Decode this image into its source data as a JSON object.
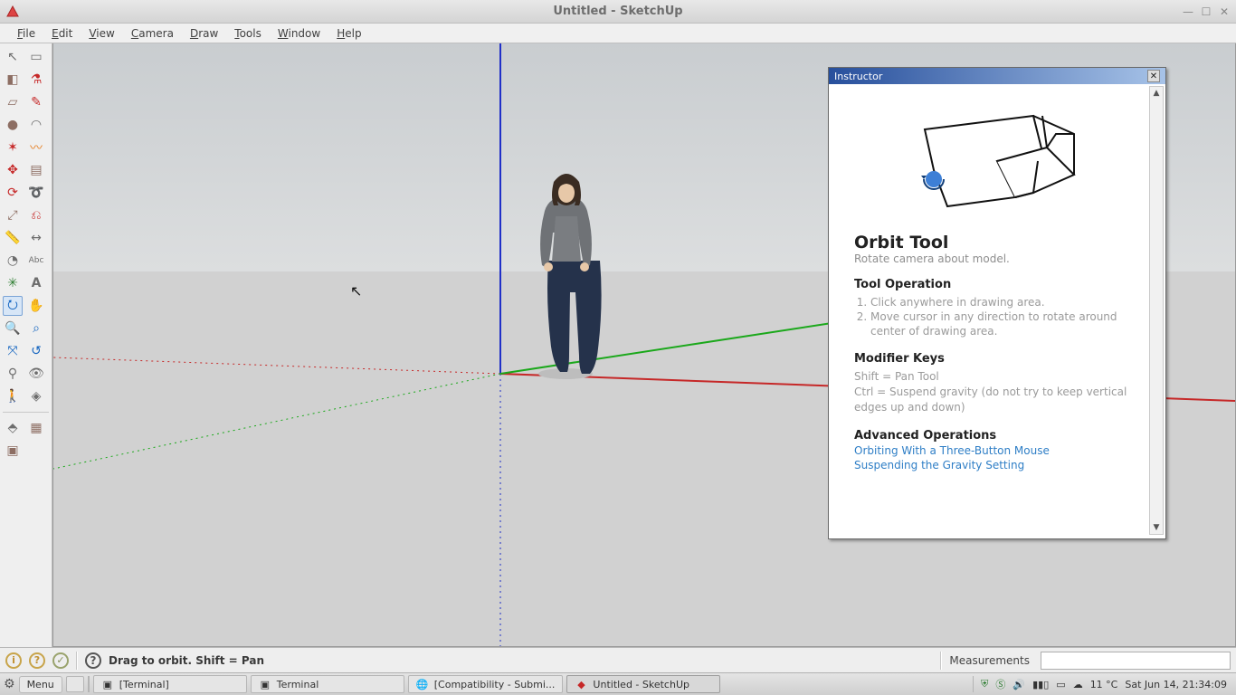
{
  "window": {
    "title": "Untitled - SketchUp"
  },
  "menubar": {
    "items": [
      "File",
      "Edit",
      "View",
      "Camera",
      "Draw",
      "Tools",
      "Window",
      "Help"
    ]
  },
  "instructor": {
    "panel_title": "Instructor",
    "tool_title": "Orbit Tool",
    "tool_desc": "Rotate camera about model.",
    "op_heading": "Tool Operation",
    "op_steps": [
      "Click anywhere in drawing area.",
      "Move cursor in any direction to rotate around center of drawing area."
    ],
    "mod_heading": "Modifier Keys",
    "mod_lines": [
      "Shift = Pan Tool",
      "Ctrl = Suspend gravity (do not try to keep vertical edges up and down)"
    ],
    "adv_heading": "Advanced Operations",
    "adv_links": [
      "Orbiting With a Three-Button Mouse",
      "Suspending the Gravity Setting"
    ]
  },
  "statusbar": {
    "hint": "Drag to orbit.  Shift = Pan",
    "measurements_label": "Measurements"
  },
  "taskbar": {
    "menu_label": "Menu",
    "tasks": [
      {
        "label": "[Terminal]"
      },
      {
        "label": "Terminal"
      },
      {
        "label": "[Compatibility - Submi..."
      },
      {
        "label": "Untitled - SketchUp"
      }
    ],
    "weather": "11 °C",
    "clock": "Sat Jun 14, 21:34:09"
  },
  "tool_icons": [
    [
      "select-icon",
      "rectangle-add-icon"
    ],
    [
      "eraser-icon",
      "paint-bucket-icon"
    ],
    [
      "rectangle-icon",
      "line-icon"
    ],
    [
      "circle-icon",
      "arc-icon"
    ],
    [
      "polygon-icon",
      "freehand-icon"
    ],
    [
      "move-icon",
      "pushpull-icon"
    ],
    [
      "rotate-icon",
      "followme-icon"
    ],
    [
      "scale-icon",
      "offset-icon"
    ],
    [
      "tape-icon",
      "dimension-icon"
    ],
    [
      "protractor-icon",
      "text-icon"
    ],
    [
      "axes-icon",
      "3dtext-icon"
    ],
    [
      "orbit-icon",
      "pan-icon"
    ],
    [
      "zoom-icon",
      "zoomwindow-icon"
    ],
    [
      "zoomextents-icon",
      "previous-icon"
    ],
    [
      "position-icon",
      "lookaround-icon"
    ],
    [
      "walk-icon",
      "sectionplane-icon"
    ]
  ],
  "tool_icons2": [
    [
      "makegroup-icon",
      "makecomponent-icon"
    ],
    [
      "explode-icon",
      ""
    ]
  ]
}
